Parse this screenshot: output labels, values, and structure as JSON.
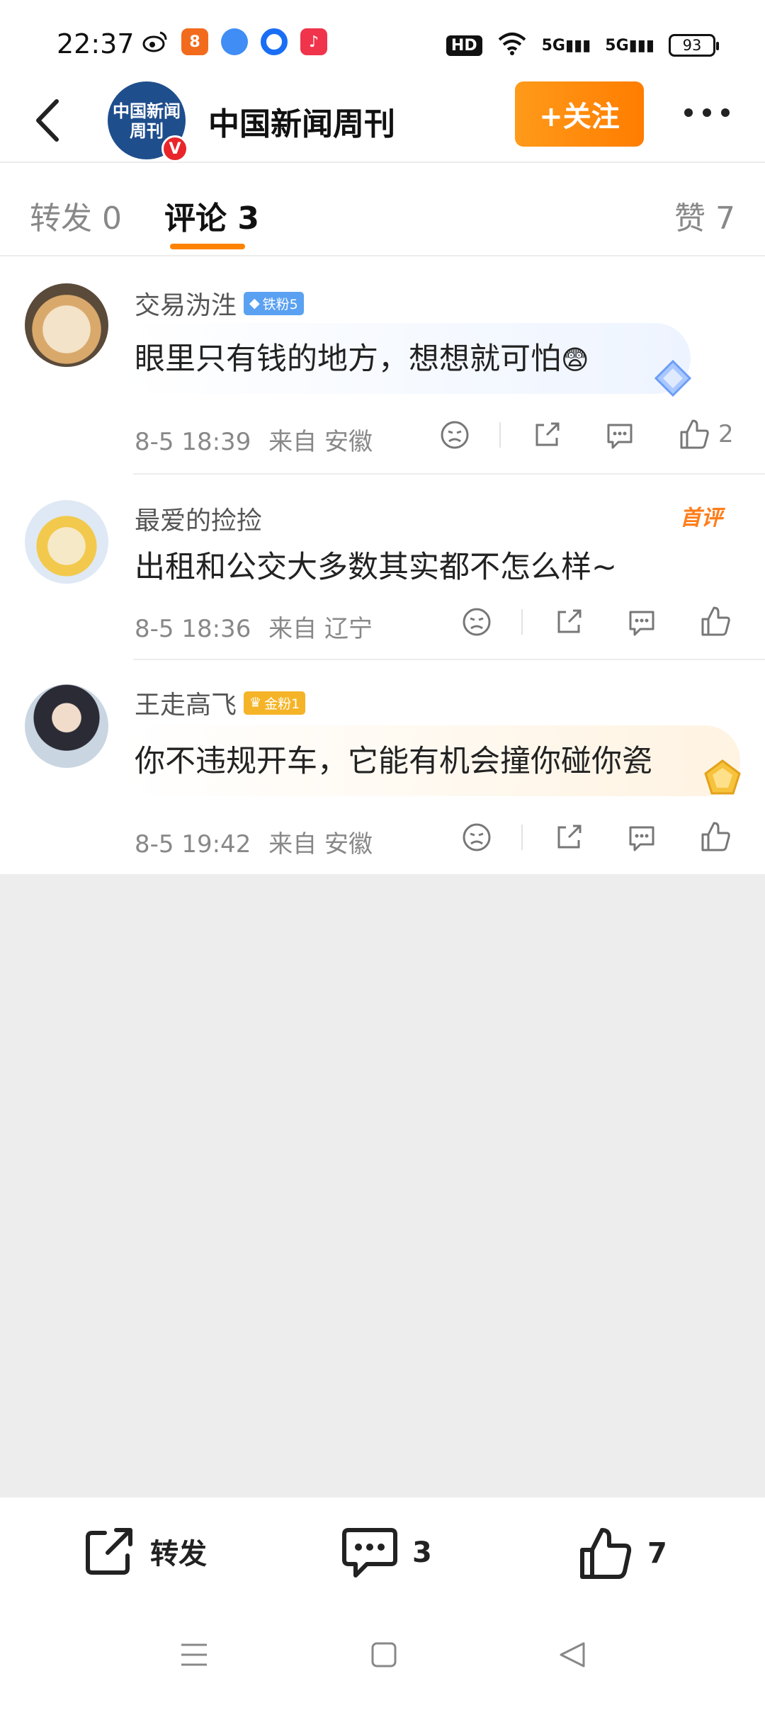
{
  "status_bar": {
    "time": "22:37",
    "hd": "HD",
    "signal1": "5G",
    "signal2": "5G",
    "battery": "93"
  },
  "header": {
    "account_name": "中国新闻周刊",
    "avatar_text": "中国新闻周刊",
    "verified": "V",
    "follow_label": "+关注"
  },
  "tabs": [
    {
      "label": "转发 0"
    },
    {
      "label": "评论 3"
    },
    {
      "label": "赞 7"
    }
  ],
  "comments": [
    {
      "username": "交易沩泩",
      "badge": "铁粉5",
      "text": "眼里只有钱的地方，想想就可怕",
      "time": "8-5 18:39",
      "location": "来自 安徽",
      "likes": "2"
    },
    {
      "username": "最爱的捡捡",
      "badge": "",
      "tag": "首评",
      "text": "出租和公交大多数其实都不怎么样~",
      "time": "8-5 18:36",
      "location": "来自 辽宁",
      "likes": ""
    },
    {
      "username": "王走高飞",
      "badge": "金粉1",
      "text": "你不违规开车，它能有机会撞你碰你瓷",
      "time": "8-5 19:42",
      "location": "来自 安徽",
      "likes": ""
    }
  ],
  "bottom_bar": {
    "repost_label": "转发",
    "comment_count": "3",
    "like_count": "7"
  },
  "colors": {
    "accent": "#ff8200",
    "background_grey": "#ededed"
  }
}
